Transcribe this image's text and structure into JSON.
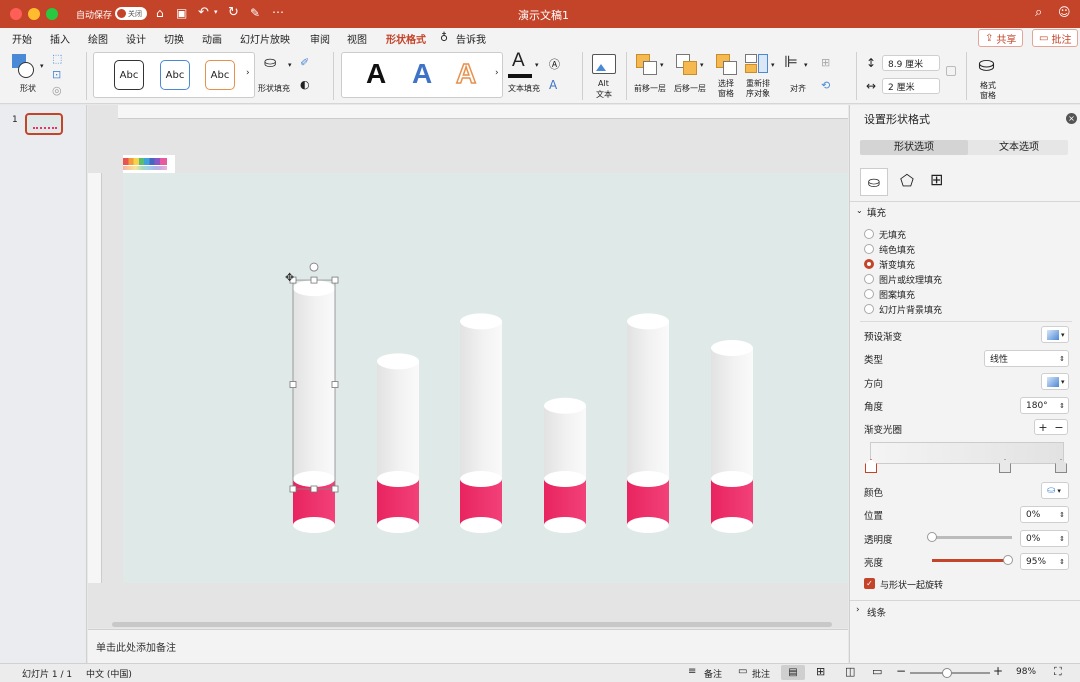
{
  "window": {
    "title": "演示文稿1",
    "autosave_label": "自动保存",
    "autosave_state": "关闭"
  },
  "tabs": [
    "开始",
    "插入",
    "绘图",
    "设计",
    "切换",
    "动画",
    "幻灯片放映",
    "审阅",
    "视图",
    "形状格式",
    "告诉我"
  ],
  "active_tab": "形状格式",
  "share_label": "共享",
  "comments_label": "批注",
  "ribbon": {
    "shape_label": "形状",
    "style_preview_text": "Abc",
    "shape_fill_label": "形状填充",
    "text_fill_label": "文本填充",
    "wordart_letter": "A",
    "alt_text_label": "Alt\n文本",
    "alt_text_line1": "Alt",
    "alt_text_line2": "文本",
    "bring_forward_label": "前移一层",
    "send_backward_label": "后移一层",
    "selection_pane_line1": "选择",
    "selection_pane_line2": "窗格",
    "reorder_line1": "重新排",
    "reorder_line2": "序对象",
    "align_label": "对齐",
    "height_value": "8.9 厘米",
    "width_value": "2 厘米",
    "format_pane_line1": "格式",
    "format_pane_line2": "窗格"
  },
  "thumbnail_number": "1",
  "notes_placeholder": "单击此处添加备注",
  "panel": {
    "title": "设置形状格式",
    "tab_shape": "形状选项",
    "tab_text": "文本选项",
    "fill_section": "填充",
    "fill_options": [
      "无填充",
      "纯色填充",
      "渐变填充",
      "图片或纹理填充",
      "图案填充",
      "幻灯片背景填充"
    ],
    "selected_fill": "渐变填充",
    "preset_gradient_label": "预设渐变",
    "type_label": "类型",
    "type_value": "线性",
    "direction_label": "方向",
    "angle_label": "角度",
    "angle_value": "180°",
    "gradient_stops_label": "渐变光圈",
    "color_label": "颜色",
    "position_label": "位置",
    "position_value": "0%",
    "transparency_label": "透明度",
    "transparency_value": "0%",
    "transparency_level": 0,
    "brightness_label": "亮度",
    "brightness_value": "95%",
    "brightness_level": 0.95,
    "rotate_with_shape_label": "与形状一起旋转",
    "line_section": "线条"
  },
  "status": {
    "slide": "幻灯片 1 / 1",
    "language": "中文 (中国)",
    "notes": "备注",
    "comments": "批注",
    "zoom": "98%"
  },
  "slide": {
    "cylinder_heights": [
      0.86,
      0.53,
      0.71,
      0.33,
      0.71,
      0.59
    ]
  },
  "colors": {
    "accent": "#c4442a",
    "pink": "#ee2f6b",
    "slide_bg": "#dfe9e8"
  }
}
